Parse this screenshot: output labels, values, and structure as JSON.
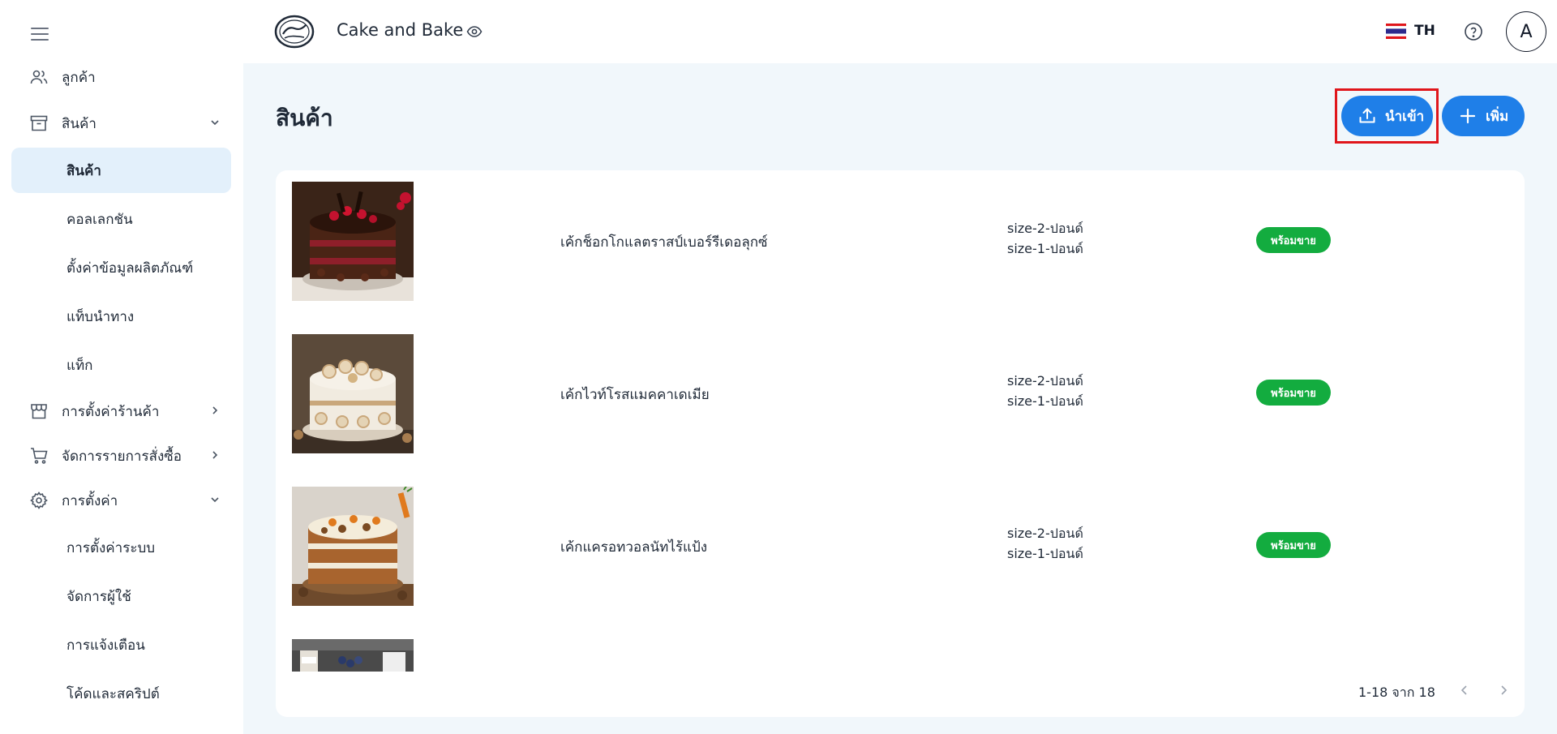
{
  "header": {
    "shop_name": "Cake and Bake",
    "language": "TH",
    "avatar_initial": "A"
  },
  "sidebar": {
    "items": [
      {
        "label": "ลูกค้า",
        "icon": "users-icon"
      },
      {
        "label": "สินค้า",
        "icon": "archive-box-icon",
        "expanded": true
      },
      {
        "label": "การตั้งค่าร้านค้า",
        "icon": "storefront-icon"
      },
      {
        "label": "จัดการรายการสั่งซื้อ",
        "icon": "cart-icon"
      },
      {
        "label": "การตั้งค่า",
        "icon": "gear-icon",
        "expanded": true
      }
    ],
    "product_sub": [
      {
        "label": "สินค้า",
        "active": true
      },
      {
        "label": "คอลเลกชัน"
      },
      {
        "label": "ตั้งค่าข้อมูลผลิตภัณฑ์"
      },
      {
        "label": "แท็บนำทาง"
      },
      {
        "label": "แท็ก"
      }
    ],
    "settings_sub": [
      {
        "label": "การตั้งค่าระบบ"
      },
      {
        "label": "จัดการผู้ใช้"
      },
      {
        "label": "การแจ้งเตือน"
      },
      {
        "label": "โค้ดและสคริปต์"
      }
    ]
  },
  "page": {
    "title": "สินค้า",
    "import_label": "นำเข้า",
    "add_label": "เพิ่ม"
  },
  "products": [
    {
      "name": "เค้กช็อกโกแลตราสป์เบอร์รีเดอลุกซ์",
      "variants": [
        "size-2-ปอนด์",
        "size-1-ปอนด์"
      ],
      "status": "พร้อมขาย"
    },
    {
      "name": "เค้กไวท์โรสแมคคาเดเมีย",
      "variants": [
        "size-2-ปอนด์",
        "size-1-ปอนด์"
      ],
      "status": "พร้อมขาย"
    },
    {
      "name": "เค้กแครอทวอลนัทไร้แป้ง",
      "variants": [
        "size-2-ปอนด์",
        "size-1-ปอนด์"
      ],
      "status": "พร้อมขาย"
    }
  ],
  "pagination": {
    "summary": "1-18 จาก 18"
  },
  "colors": {
    "primary": "#1f7fe8",
    "status_green": "#13ac3f",
    "highlight_red": "#e0161b",
    "page_bg": "#f1f7fb"
  }
}
